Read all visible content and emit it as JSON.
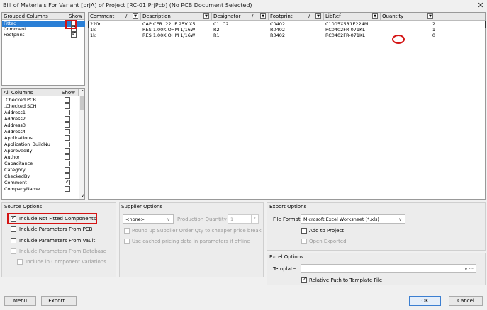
{
  "window": {
    "title": "Bill of Materials For Variant [prjA] of Project [RC-01.PrjPcb] (No PCB Document Selected)",
    "close_glyph": "✕"
  },
  "grouped": {
    "header_name": "Grouped Columns",
    "header_show": "Show",
    "rows": [
      {
        "label": "Fitted",
        "checked": false,
        "selected": true
      },
      {
        "label": "Comment",
        "checked": true
      },
      {
        "label": "Footprint",
        "checked": true
      }
    ]
  },
  "allcols": {
    "header_name": "All Columns",
    "header_show": "Show",
    "rows": [
      {
        "label": ".Checked PCB",
        "checked": false
      },
      {
        "label": ".Checked SCH",
        "checked": false
      },
      {
        "label": "Address1",
        "checked": false
      },
      {
        "label": "Address2",
        "checked": false
      },
      {
        "label": "Address3",
        "checked": false
      },
      {
        "label": "Address4",
        "checked": false
      },
      {
        "label": "Applications",
        "checked": false
      },
      {
        "label": "Application_BuildNu",
        "checked": false
      },
      {
        "label": "ApprovedBy",
        "checked": false
      },
      {
        "label": "Author",
        "checked": false
      },
      {
        "label": "Capacitance",
        "checked": false
      },
      {
        "label": "Category",
        "checked": false
      },
      {
        "label": "CheckedBy",
        "checked": false
      },
      {
        "label": "Comment",
        "checked": true
      },
      {
        "label": "CompanyName",
        "checked": false
      }
    ]
  },
  "grid": {
    "headers": [
      "Comment",
      "Description",
      "Designator",
      "Footprint",
      "LibRef",
      "Quantity"
    ],
    "rows": [
      [
        "220n",
        "CAP CER .22UF 25V X5",
        "C1, C2",
        "C0402",
        "C1005X5R1E224M",
        "2"
      ],
      [
        "1k",
        "RES 1.00K OHM 1/16W",
        "R2",
        "R0402",
        "RC0402FR-071KL",
        "1"
      ],
      [
        "1k",
        "RES 1.00K OHM 1/16W",
        "R1",
        "R0402",
        "RC0402FR-071KL",
        "0"
      ]
    ]
  },
  "source": {
    "title": "Source Options",
    "opt1": "Include Not Fitted Components",
    "opt2": "Include Parameters From PCB",
    "opt3": "Include Parameters From Vault",
    "opt4": "Include Parameters From Database",
    "opt5": "Include in Component Variations"
  },
  "supplier": {
    "title": "Supplier Options",
    "select": "<none>",
    "pq_label": "Production Quantity",
    "pq_value": "1",
    "opt1": "Round up Supplier Order Qty to cheaper price break",
    "opt2": "Use cached pricing data in parameters if offline"
  },
  "export": {
    "title": "Export Options",
    "format_label": "File Format",
    "format_value": "Microsoft Excel Worksheet (*.xls)",
    "add": "Add to Project",
    "open": "Open Exported"
  },
  "excel": {
    "title": "Excel Options",
    "template_label": "Template",
    "template_value": "",
    "relative": "Relative Path to Template File"
  },
  "buttons": {
    "menu": "Menu",
    "export": "Export...",
    "ok": "OK",
    "cancel": "Cancel"
  }
}
